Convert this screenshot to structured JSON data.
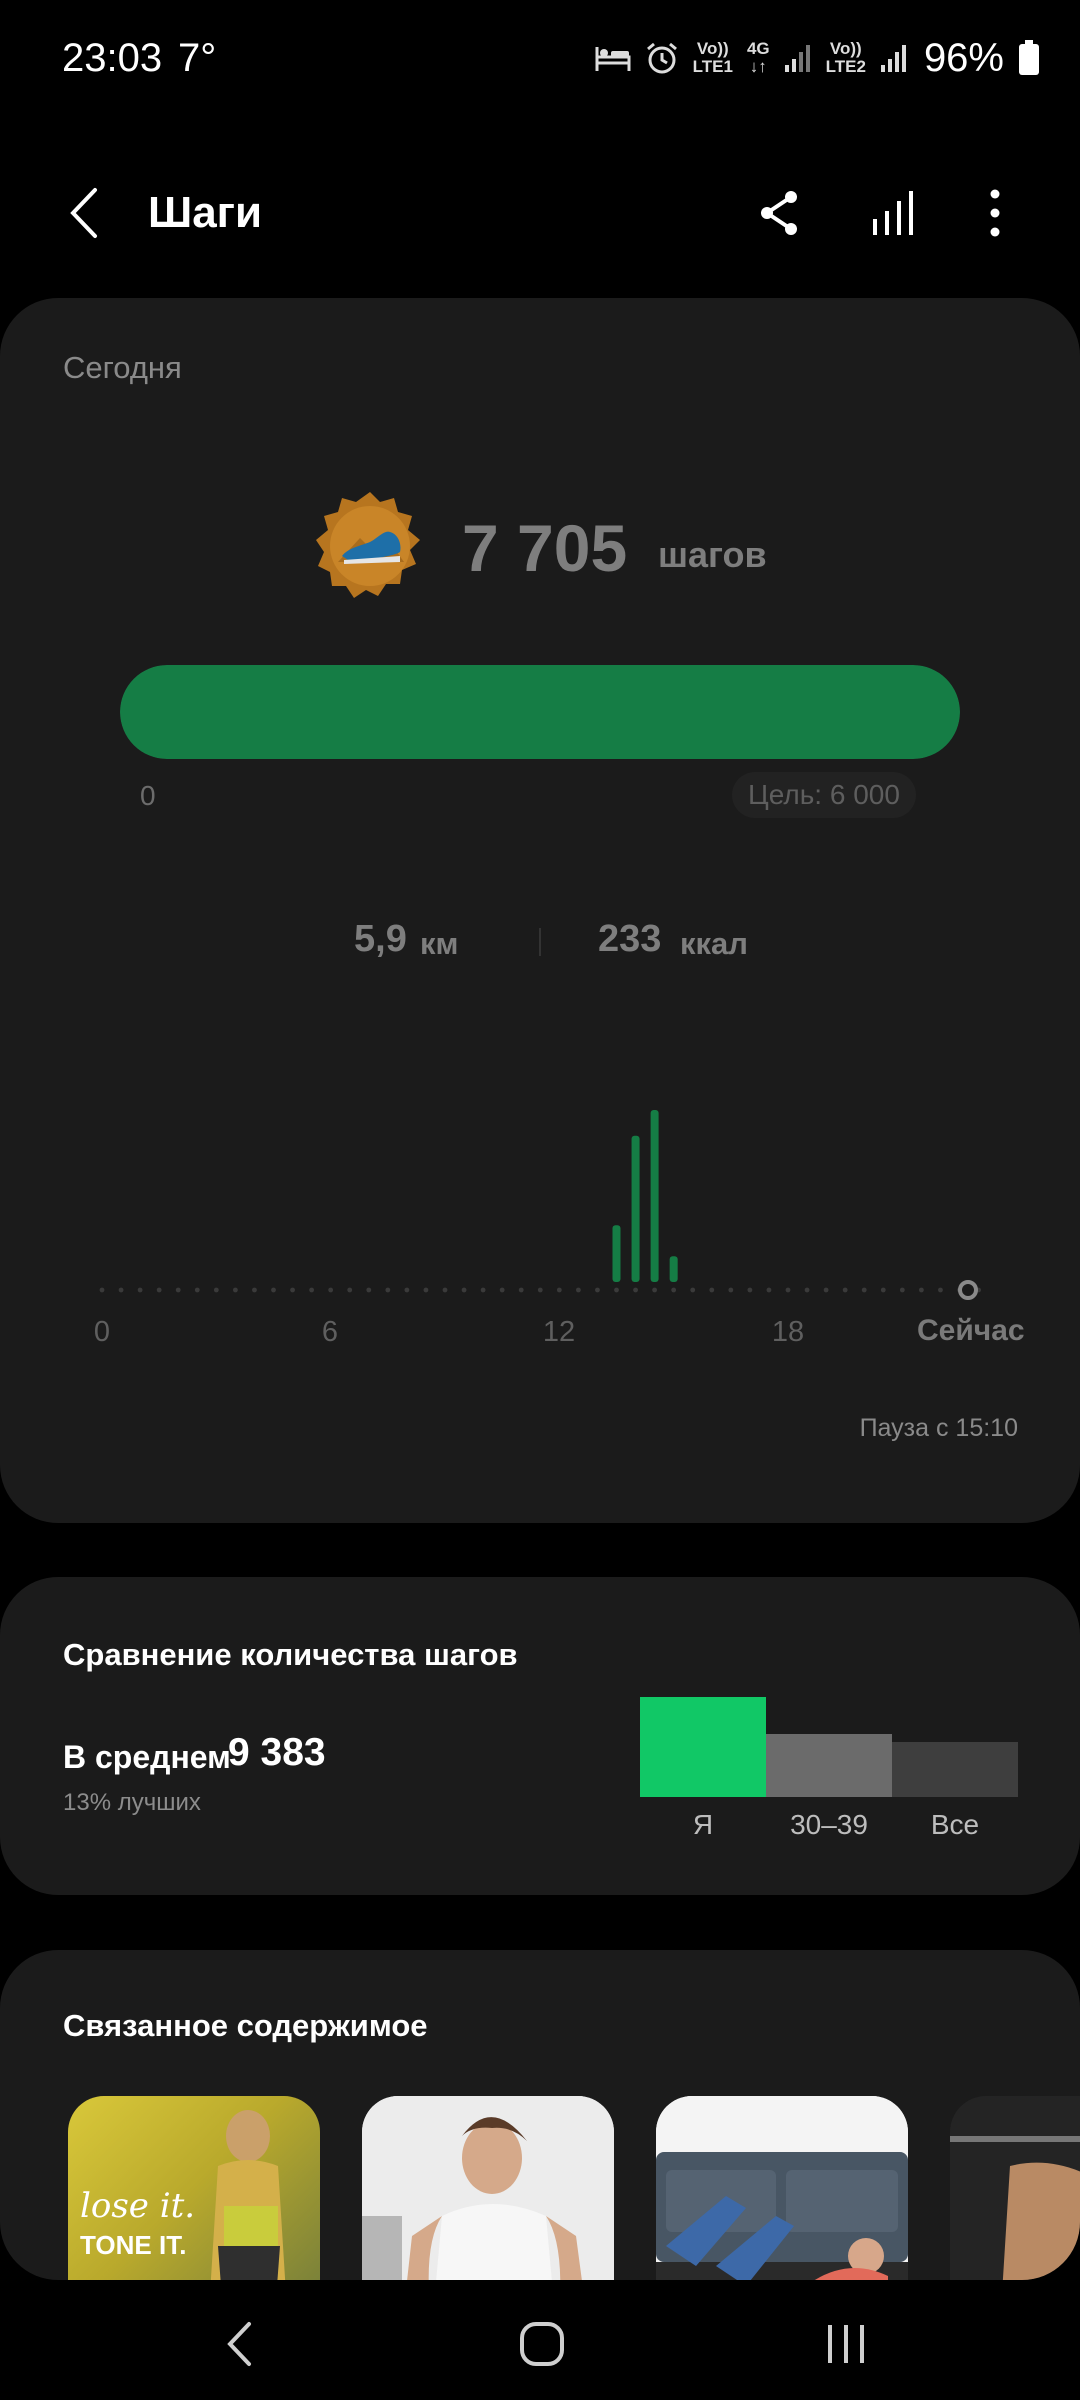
{
  "status_bar": {
    "time": "23:03",
    "temperature": "7°",
    "sim1_label_top": "Vo))",
    "sim1_label_bottom": "LTE1",
    "net_label_top": "4G",
    "sim2_label_top": "Vo))",
    "sim2_label_bottom": "LTE2",
    "battery_percent": "96%"
  },
  "header": {
    "title": "Шаги",
    "icons": [
      "back-icon",
      "share-icon",
      "bar-chart-icon",
      "more-vert-icon"
    ]
  },
  "today": {
    "label": "Сегодня",
    "steps": "7 705",
    "steps_unit": "шагов",
    "progress_min": "0",
    "goal": "Цель: 6 000",
    "progress_fraction": 1.0,
    "distance_value": "5,9",
    "distance_unit": "км",
    "calories_value": "233",
    "calories_unit": "ккал",
    "pause_text": "Пауза с 15:10"
  },
  "chart_data": {
    "type": "bar",
    "xlabel": "",
    "ylabel": "",
    "x_ticks": [
      "0",
      "6",
      "12",
      "18",
      "Сейчас"
    ],
    "x_range_hours": [
      0,
      23
    ],
    "x": [
      13.5,
      14.0,
      14.5,
      15.0
    ],
    "values": [
      0.33,
      0.85,
      1.0,
      0.15
    ],
    "bar_color": "#157d45"
  },
  "comparison": {
    "title": "Сравнение количества шагов",
    "average_label": "В среднем",
    "average_value": "9 383",
    "better_text": "13% лучших",
    "bars": [
      {
        "label": "Я",
        "value": 1.0,
        "color": "#11c866"
      },
      {
        "label": "30–39",
        "value": 0.63,
        "color": "#6b6b6b"
      },
      {
        "label": "Все",
        "value": 0.55,
        "color": "#3e3e3e"
      }
    ]
  },
  "related": {
    "title": "Связанное содержимое",
    "thumb1_text_line1": "lose it.",
    "thumb1_text_line2": "TONE IT."
  },
  "nav": {
    "icons": [
      "nav-back-icon",
      "nav-home-icon",
      "nav-recents-icon"
    ]
  },
  "colors": {
    "accent_green": "#157d45",
    "bright_green": "#11c866",
    "card_bg": "#1b1b1b"
  }
}
